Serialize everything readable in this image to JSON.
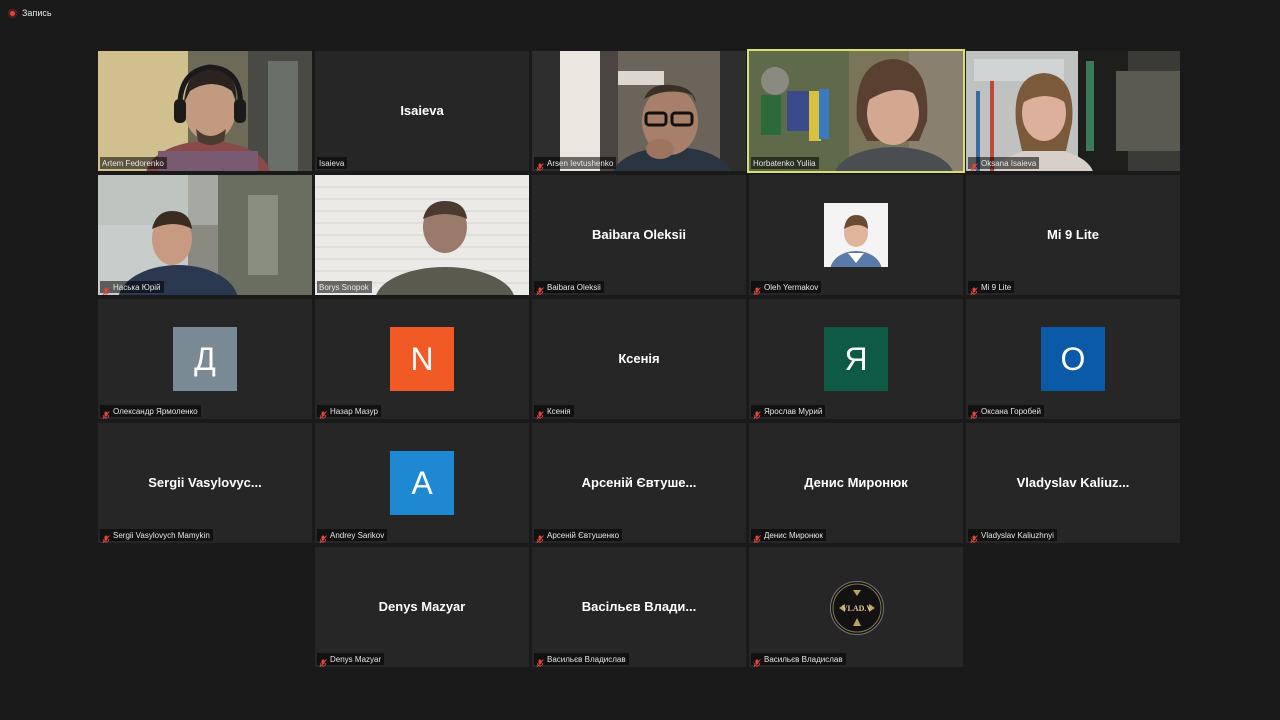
{
  "recording": {
    "label": "Запись"
  },
  "tiles": [
    {
      "name": "Artem Fedorenko",
      "mode": "video",
      "scene": "man-headphones",
      "muted": false
    },
    {
      "name": "Isaieva",
      "display": "Isaieva",
      "mode": "name",
      "muted": false
    },
    {
      "name": "Arsen Ievtushenko",
      "mode": "video",
      "scene": "man-glasses",
      "muted": true
    },
    {
      "name": "Horbatenko Yuliia",
      "mode": "video",
      "scene": "woman-room",
      "muted": false,
      "active": true
    },
    {
      "name": "Oksana Isaieva",
      "mode": "video",
      "scene": "woman-lab",
      "muted": true
    },
    {
      "name": "Наська Юрій",
      "mode": "video",
      "scene": "man-blur",
      "muted": true
    },
    {
      "name": "Borys Snopok",
      "mode": "video",
      "scene": "man-bricks",
      "muted": false
    },
    {
      "name": "Baibara Oleksii",
      "display": "Baibara Oleksii",
      "mode": "name",
      "muted": true
    },
    {
      "name": "Oleh Yermakov",
      "mode": "photo",
      "muted": true
    },
    {
      "name": "Mi 9 Lite",
      "display": "Mi 9 Lite",
      "mode": "name",
      "muted": true
    },
    {
      "name": "Олександр Ярмоленко",
      "mode": "avatar",
      "letter": "Д",
      "color": "#7a8a94",
      "muted": true
    },
    {
      "name": "Назар Мазур",
      "mode": "avatar",
      "letter": "N",
      "color": "#f15a24",
      "muted": true
    },
    {
      "name": "Ксенія",
      "display": "Ксенія",
      "mode": "name",
      "muted": true
    },
    {
      "name": "Ярослав Мурий",
      "mode": "avatar",
      "letter": "Я",
      "color": "#0e5a45",
      "muted": true
    },
    {
      "name": "Оксана Горобей",
      "mode": "avatar",
      "letter": "O",
      "color": "#0a5aa8",
      "muted": true
    },
    {
      "name": "Sergii Vasylovych Mamykin",
      "display": "Sergii  Vasylovyc...",
      "mode": "name",
      "muted": true
    },
    {
      "name": "Andrey Sarikov",
      "mode": "avatar",
      "letter": "A",
      "color": "#1e88d2",
      "muted": true
    },
    {
      "name": "Арсеній Євтушенко",
      "display": "Арсеній Євтуше...",
      "mode": "name",
      "muted": true
    },
    {
      "name": "Денис Миронюк",
      "display": "Денис Миронюк",
      "mode": "name",
      "muted": true
    },
    {
      "name": "Vladyslav Kaliuzhnyi",
      "display": "Vladyslav  Kaliuz...",
      "mode": "name",
      "muted": true
    },
    {
      "name": "Denys Mazyar",
      "display": "Denys Mazyar",
      "mode": "name",
      "muted": true
    },
    {
      "name": "Васильєв Владислав",
      "display": "Васільєв Влади...",
      "mode": "name",
      "muted": true
    },
    {
      "name": "Васильєв Владислав",
      "mode": "logo",
      "logo_text": "VLAD.V",
      "muted": true
    }
  ]
}
